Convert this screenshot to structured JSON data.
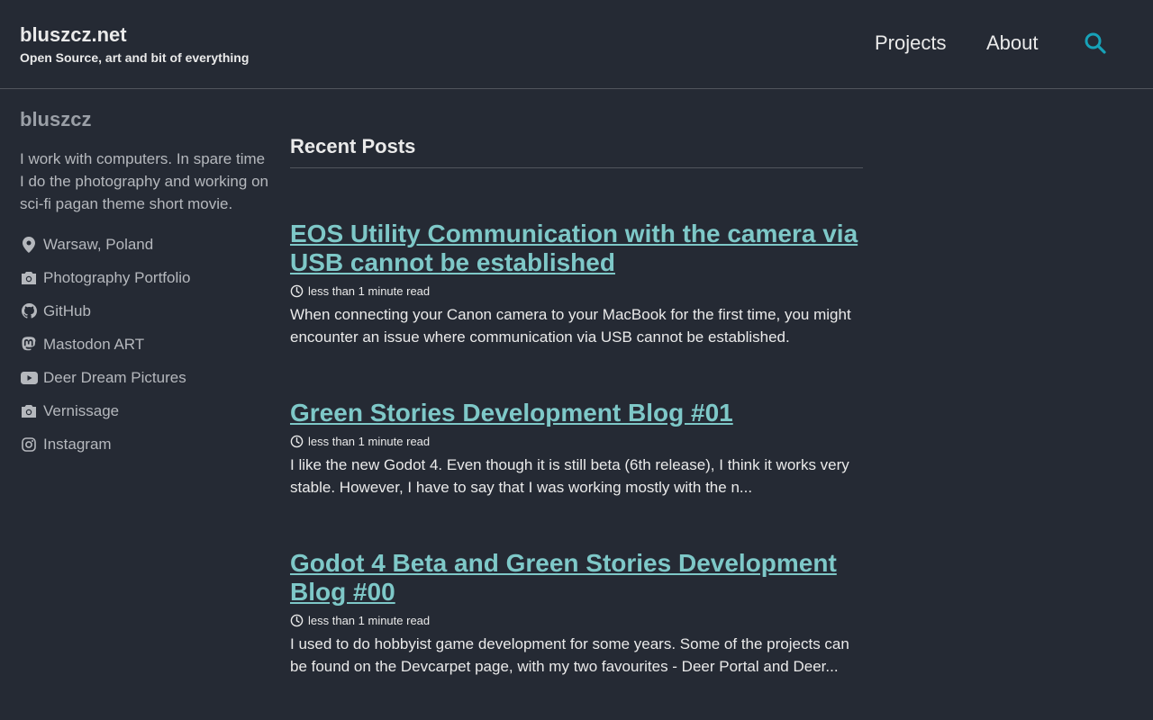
{
  "site": {
    "title": "bluszcz.net",
    "subtitle": "Open Source, art and bit of everything"
  },
  "nav": {
    "items": [
      {
        "label": "Projects"
      },
      {
        "label": "About"
      }
    ],
    "search_icon": "search-icon",
    "accent_color": "#17a2b8"
  },
  "author": {
    "name": "bluszcz",
    "bio": "I work with computers. In spare time I do the photography and working on sci-fi pagan theme short movie.",
    "links": [
      {
        "icon": "map-marker-icon",
        "label": "Warsaw, Poland"
      },
      {
        "icon": "camera-icon",
        "label": "Photography Portfolio"
      },
      {
        "icon": "github-icon",
        "label": "GitHub"
      },
      {
        "icon": "mastodon-icon",
        "label": "Mastodon ART"
      },
      {
        "icon": "youtube-icon",
        "label": "Deer Dream Pictures"
      },
      {
        "icon": "camera-icon",
        "label": "Vernissage"
      },
      {
        "icon": "instagram-icon",
        "label": "Instagram"
      }
    ]
  },
  "main": {
    "section_title": "Recent Posts",
    "posts": [
      {
        "title": "EOS Utility Communication with the camera via USB cannot be established",
        "read_time": "less than 1 minute read",
        "excerpt": "When connecting your Canon camera to your MacBook for the first time, you might encounter an issue where communication via USB cannot be established."
      },
      {
        "title": "Green Stories Development Blog #01",
        "read_time": "less than 1 minute read",
        "excerpt": "I like the new Godot 4. Even though it is still beta (6th release), I think it works very stable. However, I have to say that I was working mostly with the n..."
      },
      {
        "title": "Godot 4 Beta and Green Stories Development Blog #00",
        "read_time": "less than 1 minute read",
        "excerpt": "I used to do hobbyist game development for some years. Some of the projects can be found on the Devcarpet page, with my two favourites - Deer Portal and Deer..."
      }
    ]
  },
  "colors": {
    "background": "#252a34",
    "link": "#7ec8c8",
    "text": "#eaeaea",
    "muted": "#b5b8bd"
  }
}
